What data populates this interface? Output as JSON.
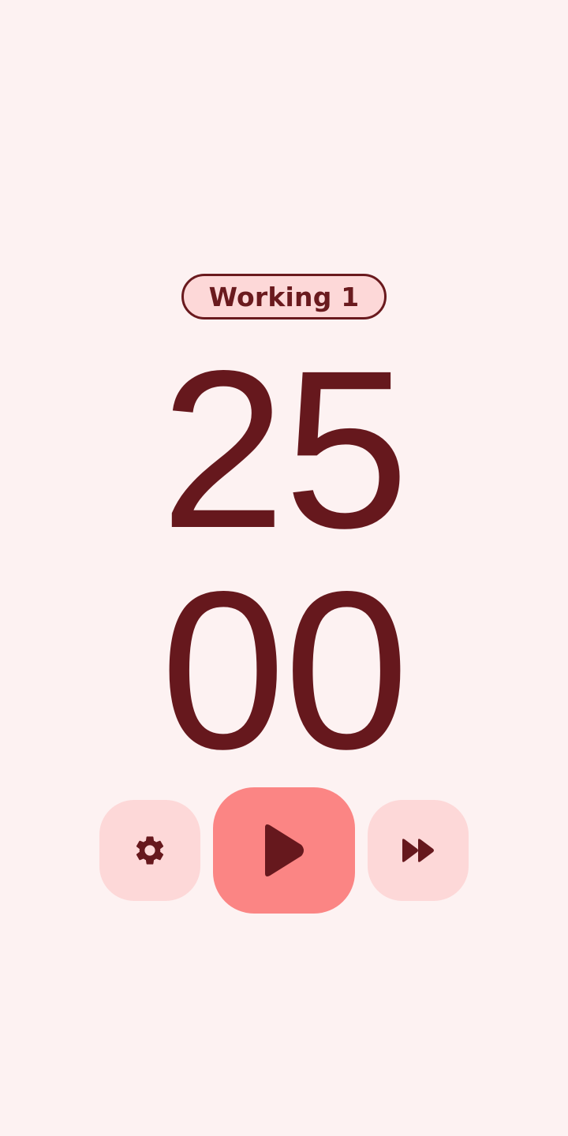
{
  "status": {
    "label": "Working 1"
  },
  "timer": {
    "minutes": "25",
    "seconds": "00"
  },
  "controls": {
    "settings_icon": "gear-icon",
    "play_icon": "play-icon",
    "skip_icon": "fast-forward-icon"
  },
  "colors": {
    "background": "#fdf2f2",
    "primary_text": "#66181d",
    "chip_fill": "#fdd8d8",
    "side_button": "#fdd8d8",
    "play_button": "#fb8584"
  }
}
